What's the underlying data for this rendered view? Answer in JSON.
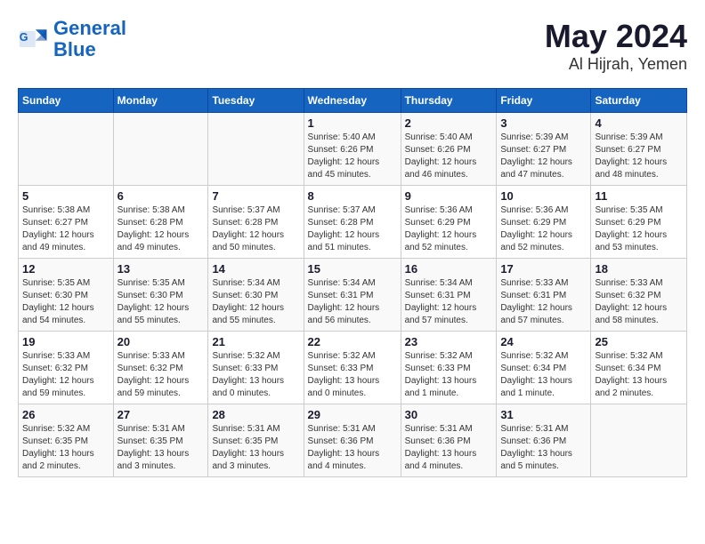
{
  "header": {
    "logo_line1": "General",
    "logo_line2": "Blue",
    "month": "May 2024",
    "location": "Al Hijrah, Yemen"
  },
  "weekdays": [
    "Sunday",
    "Monday",
    "Tuesday",
    "Wednesday",
    "Thursday",
    "Friday",
    "Saturday"
  ],
  "weeks": [
    [
      {
        "day": "",
        "info": ""
      },
      {
        "day": "",
        "info": ""
      },
      {
        "day": "",
        "info": ""
      },
      {
        "day": "1",
        "info": "Sunrise: 5:40 AM\nSunset: 6:26 PM\nDaylight: 12 hours\nand 45 minutes."
      },
      {
        "day": "2",
        "info": "Sunrise: 5:40 AM\nSunset: 6:26 PM\nDaylight: 12 hours\nand 46 minutes."
      },
      {
        "day": "3",
        "info": "Sunrise: 5:39 AM\nSunset: 6:27 PM\nDaylight: 12 hours\nand 47 minutes."
      },
      {
        "day": "4",
        "info": "Sunrise: 5:39 AM\nSunset: 6:27 PM\nDaylight: 12 hours\nand 48 minutes."
      }
    ],
    [
      {
        "day": "5",
        "info": "Sunrise: 5:38 AM\nSunset: 6:27 PM\nDaylight: 12 hours\nand 49 minutes."
      },
      {
        "day": "6",
        "info": "Sunrise: 5:38 AM\nSunset: 6:28 PM\nDaylight: 12 hours\nand 49 minutes."
      },
      {
        "day": "7",
        "info": "Sunrise: 5:37 AM\nSunset: 6:28 PM\nDaylight: 12 hours\nand 50 minutes."
      },
      {
        "day": "8",
        "info": "Sunrise: 5:37 AM\nSunset: 6:28 PM\nDaylight: 12 hours\nand 51 minutes."
      },
      {
        "day": "9",
        "info": "Sunrise: 5:36 AM\nSunset: 6:29 PM\nDaylight: 12 hours\nand 52 minutes."
      },
      {
        "day": "10",
        "info": "Sunrise: 5:36 AM\nSunset: 6:29 PM\nDaylight: 12 hours\nand 52 minutes."
      },
      {
        "day": "11",
        "info": "Sunrise: 5:35 AM\nSunset: 6:29 PM\nDaylight: 12 hours\nand 53 minutes."
      }
    ],
    [
      {
        "day": "12",
        "info": "Sunrise: 5:35 AM\nSunset: 6:30 PM\nDaylight: 12 hours\nand 54 minutes."
      },
      {
        "day": "13",
        "info": "Sunrise: 5:35 AM\nSunset: 6:30 PM\nDaylight: 12 hours\nand 55 minutes."
      },
      {
        "day": "14",
        "info": "Sunrise: 5:34 AM\nSunset: 6:30 PM\nDaylight: 12 hours\nand 55 minutes."
      },
      {
        "day": "15",
        "info": "Sunrise: 5:34 AM\nSunset: 6:31 PM\nDaylight: 12 hours\nand 56 minutes."
      },
      {
        "day": "16",
        "info": "Sunrise: 5:34 AM\nSunset: 6:31 PM\nDaylight: 12 hours\nand 57 minutes."
      },
      {
        "day": "17",
        "info": "Sunrise: 5:33 AM\nSunset: 6:31 PM\nDaylight: 12 hours\nand 57 minutes."
      },
      {
        "day": "18",
        "info": "Sunrise: 5:33 AM\nSunset: 6:32 PM\nDaylight: 12 hours\nand 58 minutes."
      }
    ],
    [
      {
        "day": "19",
        "info": "Sunrise: 5:33 AM\nSunset: 6:32 PM\nDaylight: 12 hours\nand 59 minutes."
      },
      {
        "day": "20",
        "info": "Sunrise: 5:33 AM\nSunset: 6:32 PM\nDaylight: 12 hours\nand 59 minutes."
      },
      {
        "day": "21",
        "info": "Sunrise: 5:32 AM\nSunset: 6:33 PM\nDaylight: 13 hours\nand 0 minutes."
      },
      {
        "day": "22",
        "info": "Sunrise: 5:32 AM\nSunset: 6:33 PM\nDaylight: 13 hours\nand 0 minutes."
      },
      {
        "day": "23",
        "info": "Sunrise: 5:32 AM\nSunset: 6:33 PM\nDaylight: 13 hours\nand 1 minute."
      },
      {
        "day": "24",
        "info": "Sunrise: 5:32 AM\nSunset: 6:34 PM\nDaylight: 13 hours\nand 1 minute."
      },
      {
        "day": "25",
        "info": "Sunrise: 5:32 AM\nSunset: 6:34 PM\nDaylight: 13 hours\nand 2 minutes."
      }
    ],
    [
      {
        "day": "26",
        "info": "Sunrise: 5:32 AM\nSunset: 6:35 PM\nDaylight: 13 hours\nand 2 minutes."
      },
      {
        "day": "27",
        "info": "Sunrise: 5:31 AM\nSunset: 6:35 PM\nDaylight: 13 hours\nand 3 minutes."
      },
      {
        "day": "28",
        "info": "Sunrise: 5:31 AM\nSunset: 6:35 PM\nDaylight: 13 hours\nand 3 minutes."
      },
      {
        "day": "29",
        "info": "Sunrise: 5:31 AM\nSunset: 6:36 PM\nDaylight: 13 hours\nand 4 minutes."
      },
      {
        "day": "30",
        "info": "Sunrise: 5:31 AM\nSunset: 6:36 PM\nDaylight: 13 hours\nand 4 minutes."
      },
      {
        "day": "31",
        "info": "Sunrise: 5:31 AM\nSunset: 6:36 PM\nDaylight: 13 hours\nand 5 minutes."
      },
      {
        "day": "",
        "info": ""
      }
    ]
  ]
}
